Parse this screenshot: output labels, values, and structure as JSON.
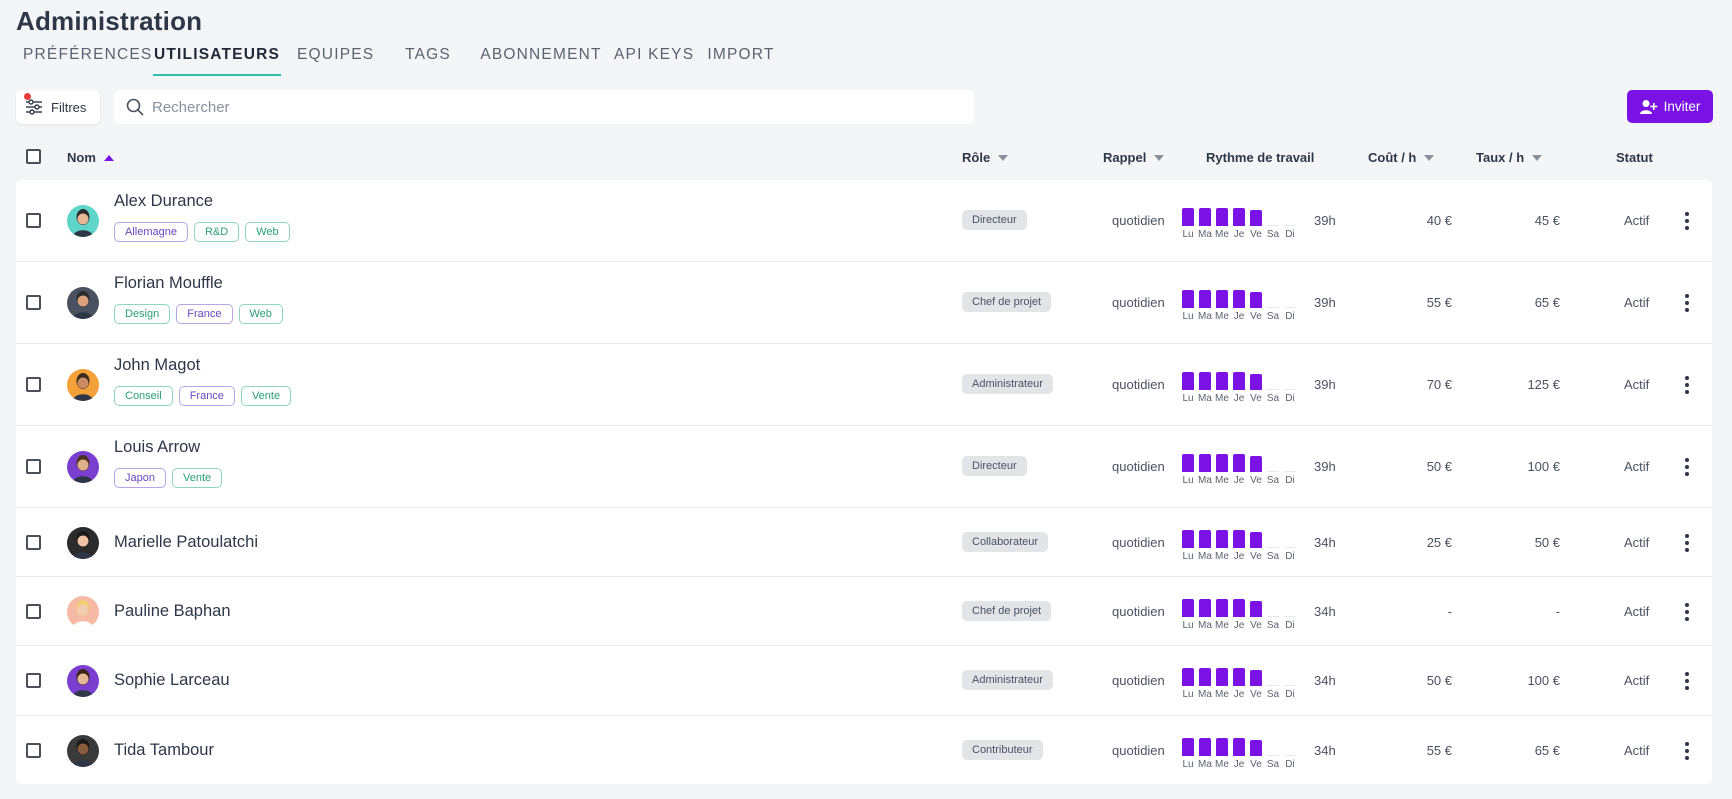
{
  "page": {
    "title": "Administration"
  },
  "tabs": [
    {
      "label": "PRÉFÉRENCES",
      "active": false
    },
    {
      "label": "UTILISATEURS",
      "active": true
    },
    {
      "label": "EQUIPES",
      "active": false
    },
    {
      "label": "TAGS",
      "active": false
    },
    {
      "label": "ABONNEMENT",
      "active": false
    },
    {
      "label": "API KEYS",
      "active": false
    },
    {
      "label": "IMPORT",
      "active": false
    }
  ],
  "toolbar": {
    "filter_label": "Filtres",
    "search_placeholder": "Rechercher",
    "invite_label": "Inviter"
  },
  "table": {
    "headers": {
      "nom": "Nom",
      "role": "Rôle",
      "rappel": "Rappel",
      "rythme": "Rythme de travail",
      "cout": "Coût / h",
      "taux": "Taux / h",
      "statut": "Statut"
    },
    "days": [
      "Lu",
      "Ma",
      "Me",
      "Je",
      "Ve",
      "Sa",
      "Di"
    ],
    "rows": [
      {
        "name": "Alex Durance",
        "tags": [
          {
            "label": "Allemagne",
            "color": "purple"
          },
          {
            "label": "R&D",
            "color": "green"
          },
          {
            "label": "Web",
            "color": "green"
          }
        ],
        "role": "Directeur",
        "rappel": "quotidien",
        "rhythm": [
          8,
          8,
          8,
          8,
          7,
          0,
          0
        ],
        "hours": "39h",
        "cout": "40 €",
        "taux": "45 €",
        "statut": "Actif",
        "avatar_bg": "#5fd4c8",
        "skin": "#e8b894",
        "hair": "#2b2b2b"
      },
      {
        "name": "Florian Mouffle",
        "tags": [
          {
            "label": "Design",
            "color": "green"
          },
          {
            "label": "France",
            "color": "purple"
          },
          {
            "label": "Web",
            "color": "green"
          }
        ],
        "role": "Chef de projet",
        "rappel": "quotidien",
        "rhythm": [
          8,
          8,
          8,
          8,
          7,
          0,
          0
        ],
        "hours": "39h",
        "cout": "55 €",
        "taux": "65 €",
        "statut": "Actif",
        "avatar_bg": "#4a5160",
        "skin": "#d9a27c",
        "hair": "#2b2b2b"
      },
      {
        "name": "John Magot",
        "tags": [
          {
            "label": "Conseil",
            "color": "green"
          },
          {
            "label": "France",
            "color": "purple"
          },
          {
            "label": "Vente",
            "color": "green"
          }
        ],
        "role": "Administrateur",
        "rappel": "quotidien",
        "rhythm": [
          8,
          8,
          8,
          8,
          7,
          0,
          0
        ],
        "hours": "39h",
        "cout": "70 €",
        "taux": "125 €",
        "statut": "Actif",
        "avatar_bg": "#f4a13a",
        "skin": "#c98b62",
        "hair": "#3a2a20"
      },
      {
        "name": "Louis Arrow",
        "tags": [
          {
            "label": "Japon",
            "color": "purple"
          },
          {
            "label": "Vente",
            "color": "green"
          }
        ],
        "role": "Directeur",
        "rappel": "quotidien",
        "rhythm": [
          8,
          8,
          8,
          8,
          7,
          0,
          0
        ],
        "hours": "39h",
        "cout": "50 €",
        "taux": "100 €",
        "statut": "Actif",
        "avatar_bg": "#7b3fcf",
        "skin": "#e0b08a",
        "hair": "#4a3320"
      },
      {
        "name": "Marielle Patoulatchi",
        "tags": [],
        "role": "Collaborateur",
        "rappel": "quotidien",
        "rhythm": [
          8,
          8,
          8,
          8,
          7,
          0,
          0
        ],
        "hours": "34h",
        "cout": "25 €",
        "taux": "50 €",
        "statut": "Actif",
        "avatar_bg": "#2b2b2b",
        "skin": "#efc3a4",
        "hair": "#1a1a1a"
      },
      {
        "name": "Pauline Baphan",
        "tags": [],
        "role": "Chef de projet",
        "rappel": "quotidien",
        "rhythm": [
          8,
          8,
          8,
          8,
          7,
          0,
          0
        ],
        "hours": "34h",
        "cout": "-",
        "taux": "-",
        "statut": "Actif",
        "avatar_bg": "#f6b9a3",
        "skin": "#f3cdb2",
        "hair": "#f1cf72"
      },
      {
        "name": "Sophie Larceau",
        "tags": [],
        "role": "Administrateur",
        "rappel": "quotidien",
        "rhythm": [
          8,
          8,
          8,
          8,
          7,
          0,
          0
        ],
        "hours": "34h",
        "cout": "50 €",
        "taux": "100 €",
        "statut": "Actif",
        "avatar_bg": "#7b3fcf",
        "skin": "#e5b896",
        "hair": "#3a2418"
      },
      {
        "name": "Tida Tambour",
        "tags": [],
        "role": "Contributeur",
        "rappel": "quotidien",
        "rhythm": [
          8,
          8,
          8,
          8,
          7,
          0,
          0
        ],
        "hours": "34h",
        "cout": "55 €",
        "taux": "65 €",
        "statut": "Actif",
        "avatar_bg": "#3a3a3a",
        "skin": "#8a5a3c",
        "hair": "#1a1a1a"
      }
    ]
  },
  "colors": {
    "accent": "#7a12e6",
    "tab_underline": "#2fbfa8",
    "filter_dot": "#e53e3e"
  }
}
